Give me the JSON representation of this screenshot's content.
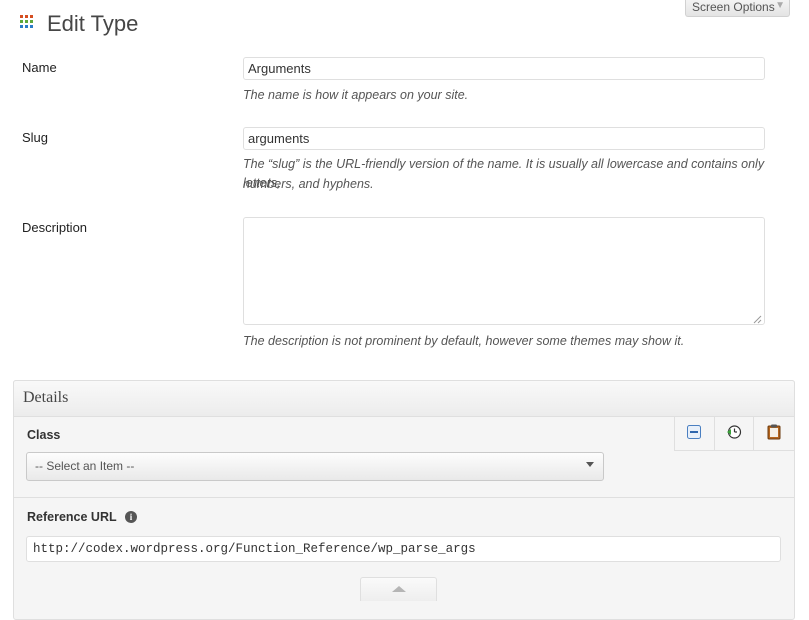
{
  "header": {
    "title": "Edit Type",
    "screen_options_label": "Screen Options",
    "icon": "grid-icon"
  },
  "form": {
    "name": {
      "label": "Name",
      "value": "Arguments",
      "hint": "The name is how it appears on your site."
    },
    "slug": {
      "label": "Slug",
      "value": "arguments",
      "hint_line1": "The “slug” is the URL-friendly version of the name. It is usually all lowercase and contains only letters,",
      "hint_line2": "numbers, and hyphens."
    },
    "description": {
      "label": "Description",
      "value": "",
      "hint": "The description is not prominent by default, however some themes may show it."
    }
  },
  "details": {
    "title": "Details",
    "class": {
      "label": "Class",
      "selected": "-- Select an Item --"
    },
    "tools": [
      "minus-icon",
      "history-icon",
      "clipboard-icon"
    ],
    "reference_url": {
      "label": "Reference URL",
      "value": "http://codex.wordpress.org/Function_Reference/wp_parse_args"
    }
  },
  "colors": {
    "grid_icon": [
      "#d54e21",
      "#5fa83b",
      "#2a7bc8"
    ]
  }
}
